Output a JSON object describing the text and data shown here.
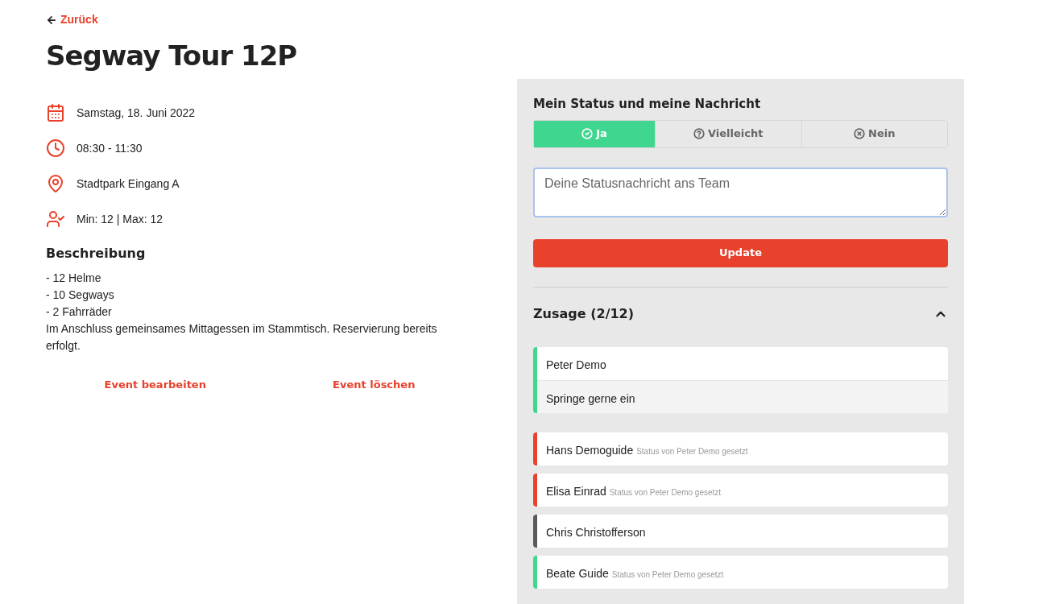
{
  "back_link": "Zurück",
  "title": "Segway Tour 12P",
  "details": [
    {
      "kind": "date",
      "text": "Samstag, 18. Juni 2022"
    },
    {
      "kind": "time",
      "text": "08:30 - 11:30"
    },
    {
      "kind": "location",
      "text": "Stadtpark Eingang A"
    },
    {
      "kind": "participants",
      "text": "Min: 12 | Max: 12"
    }
  ],
  "description": {
    "heading": "Beschreibung",
    "lines": [
      "- 12 Helme",
      "- 10 Segways",
      "- 2 Fahrräder",
      "Im Anschluss gemeinsames Mittagessen im Stammtisch. Reservierung bereits erfolgt."
    ]
  },
  "actions": [
    "Event bearbeiten",
    "Event löschen"
  ],
  "status_panel": {
    "heading": "Mein Status und meine Nachricht",
    "options": [
      {
        "kind": "yes",
        "label": "Ja",
        "selected": true
      },
      {
        "kind": "maybe",
        "label": "Vielleicht",
        "selected": false
      },
      {
        "kind": "no",
        "label": "Nein",
        "selected": false
      }
    ],
    "message": {
      "placeholder": "Deine Statusnachricht ans Team"
    },
    "button": "Update"
  },
  "responses": {
    "title": "Zusage (2/12)",
    "expanded": true,
    "members": [
      {
        "name": "Peter Demo",
        "message": "Springe gerne ein",
        "color": "#3fd68f"
      },
      {
        "name": "Hans Demoguide",
        "note": "Status von Peter Demo gesetzt",
        "color": "#e8412c"
      },
      {
        "name": "Elisa Einrad",
        "note": "Status von Peter Demo gesetzt",
        "color": "#e8412c"
      },
      {
        "name": "Chris Christofferson",
        "color": "#5a5a5a"
      },
      {
        "name": "Beate Guide",
        "note": "Status von Peter Demo gesetzt",
        "color": "#3fd68f"
      }
    ]
  }
}
